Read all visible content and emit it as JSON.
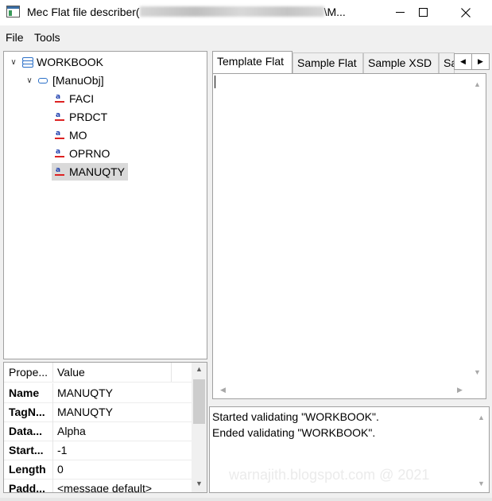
{
  "window": {
    "title_prefix": "Mec Flat file describer(",
    "title_suffix": "\\M..."
  },
  "menu": {
    "items": [
      "File",
      "Tools"
    ]
  },
  "tree": {
    "root": "WORKBOOK",
    "object": "[ManuObj]",
    "fields": [
      "FACI",
      "PRDCT",
      "MO",
      "OPRNO",
      "MANUQTY"
    ],
    "selected": "MANUQTY"
  },
  "properties": {
    "headers": [
      "Prope...",
      "Value"
    ],
    "rows": [
      {
        "key": "Name",
        "value": "MANUQTY"
      },
      {
        "key": "TagN...",
        "value": "MANUQTY"
      },
      {
        "key": "Data...",
        "value": "Alpha"
      },
      {
        "key": "Start...",
        "value": "-1"
      },
      {
        "key": "Length",
        "value": "0"
      },
      {
        "key": "Padd...",
        "value": "<message default>"
      }
    ]
  },
  "tabs": {
    "items": [
      "Template Flat",
      "Sample Flat",
      "Sample XSD",
      "Sa"
    ],
    "active": 0
  },
  "editor": {
    "content": ""
  },
  "console": {
    "lines": [
      "Started validating \"WORKBOOK\".",
      "Ended validating \"WORKBOOK\"."
    ]
  },
  "watermark": "warnajith.blogspot.com @ 2021",
  "colors": {
    "selection": "#d9d9d9",
    "tree_icon": "#2b70c8",
    "border": "#a0a0a0"
  }
}
